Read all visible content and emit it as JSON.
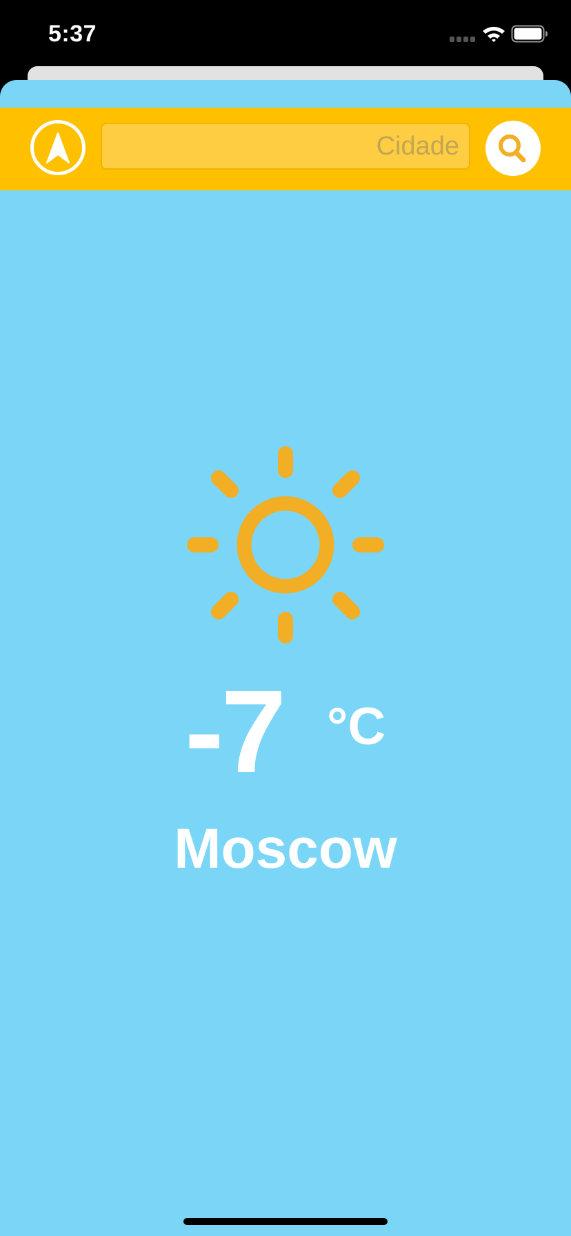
{
  "status_bar": {
    "time": "5:37",
    "icons": [
      "signal-icon",
      "wifi-icon",
      "battery-icon"
    ]
  },
  "header": {
    "location_button_icon": "location-arrow-icon",
    "search_placeholder": "Cidade",
    "search_value": "",
    "search_button_icon": "magnifier-icon"
  },
  "weather": {
    "condition_icon": "sun-icon",
    "temperature": "-7",
    "unit": "°C",
    "city": "Moscow"
  },
  "colors": {
    "sky_background": "#7ad5f7",
    "header_background": "#ffc000",
    "sun": "#f2ae24",
    "text": "#ffffff"
  }
}
